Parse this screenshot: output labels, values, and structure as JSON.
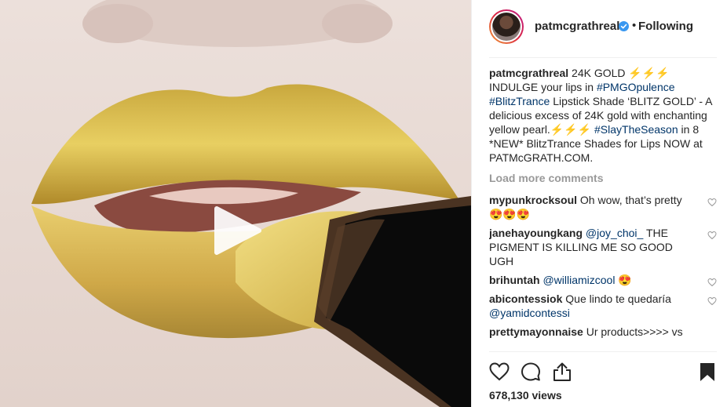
{
  "post": {
    "username": "patmcgrathreal",
    "follow_label": "Following",
    "caption": {
      "user": "patmcgrathreal",
      "seg1": "24K GOLD ⚡⚡⚡ INDULGE your lips in",
      "tag1": "#PMGOpulence",
      "tag2": "#BlitzTrance",
      "seg2": "Lipstick Shade ‘BLITZ GOLD’ - A delicious excess of 24K gold with enchanting yellow pearl.⚡⚡⚡",
      "tag3": "#SlayTheSeason",
      "seg3": "in 8 *NEW* BlitzTrance Shades for Lips NOW at PATMcGRATH.COM."
    },
    "load_more": "Load more comments",
    "comments": [
      {
        "user": "mypunkrocksoul",
        "text": "Oh wow, that’s pretty 😍😍😍"
      },
      {
        "user": "janehayoungkang",
        "mention": "@joy_choi_",
        "text": "THE PIGMENT IS KILLING ME SO GOOD UGH"
      },
      {
        "user": "brihuntah",
        "mention": "@williamizcool",
        "text": "😍"
      },
      {
        "user": "abicontessiok",
        "text": "Que lindo te quedaría",
        "mention": "@yamidcontessi"
      },
      {
        "user": "prettymayonnaise",
        "text": "Ur products>>>> vs"
      }
    ],
    "views": "678,130 views"
  },
  "icons": [
    "play-icon",
    "verified-icon",
    "heart-icon",
    "comment-icon",
    "share-icon",
    "bookmark-icon"
  ],
  "colors": {
    "link": "#003569",
    "verified": "#3897f0",
    "muted": "#999999",
    "gold": "#e0c040"
  }
}
